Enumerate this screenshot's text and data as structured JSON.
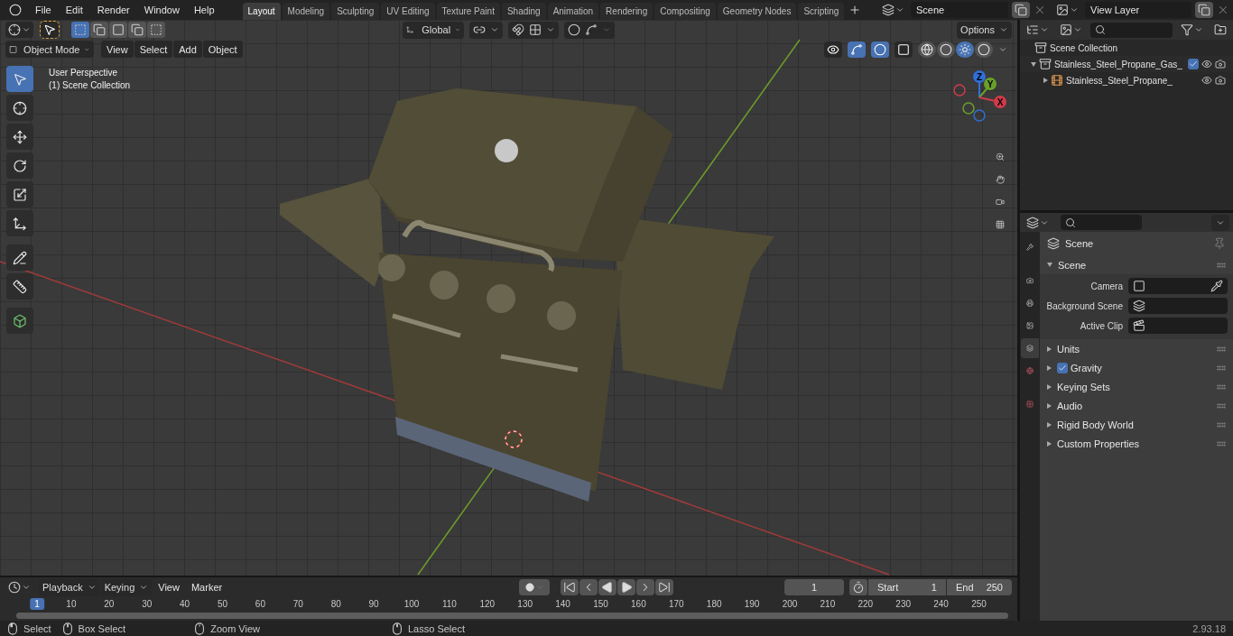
{
  "menu": [
    "File",
    "Edit",
    "Render",
    "Window",
    "Help"
  ],
  "workspaces": [
    {
      "label": "Layout",
      "selected": true
    },
    {
      "label": "Modeling",
      "selected": false
    },
    {
      "label": "Sculpting",
      "selected": false
    },
    {
      "label": "UV Editing",
      "selected": false
    },
    {
      "label": "Texture Paint",
      "selected": false
    },
    {
      "label": "Shading",
      "selected": false
    },
    {
      "label": "Animation",
      "selected": false
    },
    {
      "label": "Rendering",
      "selected": false
    },
    {
      "label": "Compositing",
      "selected": false
    },
    {
      "label": "Geometry Nodes",
      "selected": false
    },
    {
      "label": "Scripting",
      "selected": false
    }
  ],
  "scene_field": {
    "value": "Scene"
  },
  "view_layer_field": {
    "value": "View Layer"
  },
  "viewport": {
    "select_modes": [
      {
        "kind": "set",
        "selected": true
      },
      {
        "kind": "extend",
        "selected": false
      },
      {
        "kind": "subtract",
        "selected": false
      },
      {
        "kind": "invert",
        "selected": false
      },
      {
        "kind": "intersect",
        "selected": false
      }
    ],
    "orientation": "Global",
    "options": "Options",
    "mode": "Object Mode",
    "menus": [
      "View",
      "Select",
      "Add",
      "Object"
    ],
    "toggles": [
      {
        "kind": "visibility",
        "on": false
      },
      {
        "kind": "gizmo",
        "on": true
      },
      {
        "kind": "overlay",
        "on": true
      },
      {
        "kind": "xray",
        "on": false
      }
    ],
    "shading_modes": [
      {
        "kind": "wireframe",
        "selected": false
      },
      {
        "kind": "solid",
        "selected": false
      },
      {
        "kind": "material",
        "selected": true
      },
      {
        "kind": "rendered",
        "selected": false
      }
    ],
    "overlay_lines": [
      "User Perspective",
      "(1) Scene Collection"
    ],
    "tools": [
      {
        "kind": "select",
        "selected": true
      },
      {
        "kind": "cursor",
        "selected": false
      },
      {
        "kind": "move",
        "selected": false
      },
      {
        "kind": "rotate",
        "selected": false
      },
      {
        "kind": "scale",
        "selected": false
      },
      {
        "kind": "transform",
        "selected": false
      },
      {
        "kind": "annotate",
        "selected": false
      },
      {
        "kind": "measure",
        "selected": false
      },
      {
        "kind": "add_cube",
        "selected": false
      }
    ],
    "axes": [
      "X",
      "Y",
      "Z"
    ]
  },
  "outliner": {
    "root": "Scene Collection",
    "items": [
      {
        "label": "Stainless_Steel_Propane_Gas_",
        "expanded": true,
        "checked": true,
        "kind": "collection",
        "children": [
          {
            "label": "Stainless_Steel_Propane_",
            "expanded": false,
            "kind": "object"
          }
        ]
      }
    ]
  },
  "properties": {
    "context": "Scene",
    "tabs": [
      {
        "kind": "tool",
        "selected": false
      },
      {
        "kind": "render",
        "selected": false
      },
      {
        "kind": "output",
        "selected": false
      },
      {
        "kind": "view_layer",
        "selected": false
      },
      {
        "kind": "scene",
        "selected": true
      },
      {
        "kind": "world",
        "selected": false
      },
      {
        "kind": "texture",
        "selected": false
      }
    ],
    "panel": {
      "title": "Scene",
      "expanded": true,
      "fields": [
        {
          "label": "Camera",
          "kind": "camera"
        },
        {
          "label": "Background Scene",
          "kind": "scene"
        },
        {
          "label": "Active Clip",
          "kind": "clip"
        }
      ]
    },
    "sections": [
      {
        "label": "Units",
        "expanded": false,
        "kind": "plain"
      },
      {
        "label": "Gravity",
        "expanded": false,
        "kind": "checkbox",
        "checked": true
      },
      {
        "label": "Keying Sets",
        "expanded": false,
        "kind": "plain"
      },
      {
        "label": "Audio",
        "expanded": false,
        "kind": "plain"
      },
      {
        "label": "Rigid Body World",
        "expanded": false,
        "kind": "plain"
      },
      {
        "label": "Custom Properties",
        "expanded": false,
        "kind": "plain"
      }
    ]
  },
  "timeline": {
    "menus": [
      "Playback",
      "Keying",
      "View",
      "Marker"
    ],
    "current_frame": "1",
    "start_label": "Start",
    "start": "1",
    "end_label": "End",
    "end": "250",
    "ruler": [
      {
        "label": "1",
        "selected": true
      },
      {
        "label": "10",
        "selected": false
      },
      {
        "label": "20",
        "selected": false
      },
      {
        "label": "30",
        "selected": false
      },
      {
        "label": "40",
        "selected": false
      },
      {
        "label": "50",
        "selected": false
      },
      {
        "label": "60",
        "selected": false
      },
      {
        "label": "70",
        "selected": false
      },
      {
        "label": "80",
        "selected": false
      },
      {
        "label": "90",
        "selected": false
      },
      {
        "label": "100",
        "selected": false
      },
      {
        "label": "110",
        "selected": false
      },
      {
        "label": "120",
        "selected": false
      },
      {
        "label": "130",
        "selected": false
      },
      {
        "label": "140",
        "selected": false
      },
      {
        "label": "150",
        "selected": false
      },
      {
        "label": "160",
        "selected": false
      },
      {
        "label": "170",
        "selected": false
      },
      {
        "label": "180",
        "selected": false
      },
      {
        "label": "190",
        "selected": false
      },
      {
        "label": "200",
        "selected": false
      },
      {
        "label": "210",
        "selected": false
      },
      {
        "label": "220",
        "selected": false
      },
      {
        "label": "230",
        "selected": false
      },
      {
        "label": "240",
        "selected": false
      },
      {
        "label": "250",
        "selected": false
      }
    ]
  },
  "status_bar": {
    "hints": [
      {
        "kind": "left",
        "label": "Select"
      },
      {
        "kind": "middle",
        "label": "Box Select"
      },
      {
        "kind": "wheel",
        "label": "Zoom View"
      },
      {
        "kind": "middle",
        "label": "Lasso Select"
      }
    ],
    "version": "2.93.18"
  }
}
